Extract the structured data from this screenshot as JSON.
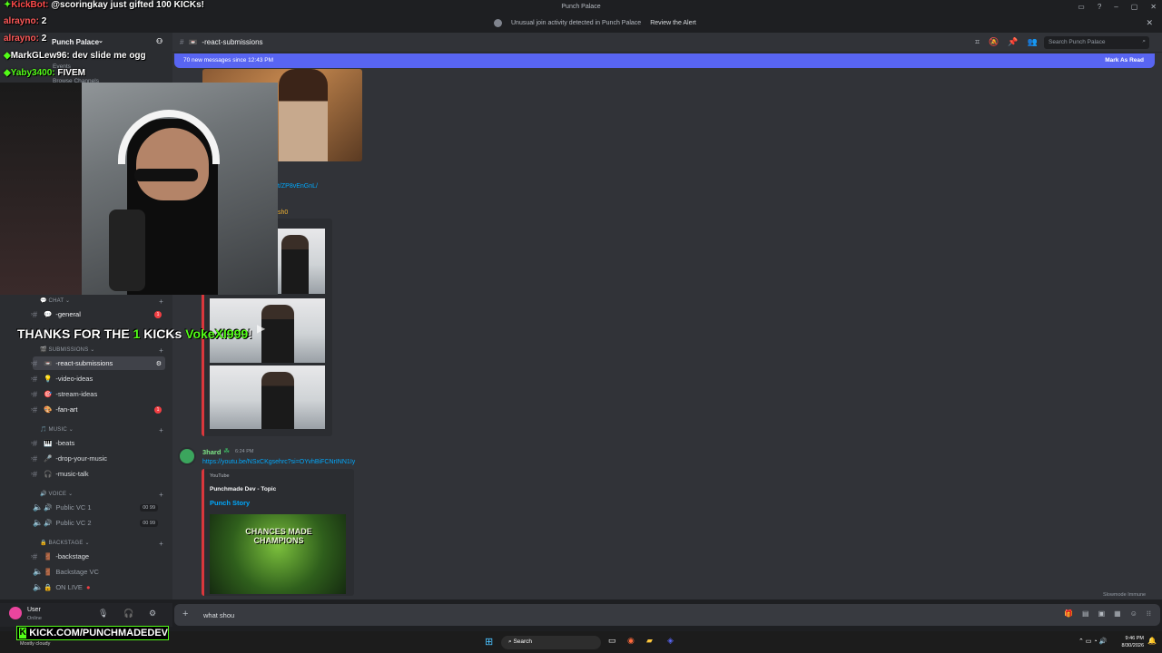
{
  "window": {
    "title": "Punch Palace"
  },
  "alert": {
    "text": "Unusual join activity detected in Punch Palace",
    "action": "Review the Alert"
  },
  "server": {
    "name": "Punch Palace",
    "hidden_items": [
      "Events",
      "Browse Channels"
    ]
  },
  "channel_header": {
    "name": "-react-submissions",
    "search_placeholder": "Search Punch Palace"
  },
  "new_messages": {
    "text": "70 new messages since 12:43 PM",
    "action": "Mark As Read"
  },
  "categories": {
    "chat": "CHAT",
    "submissions": "SUBMISSIONS",
    "music": "MUSIC",
    "voice": "VOICE",
    "backstage": "BACKSTAGE"
  },
  "channels": {
    "general": "-general",
    "react_submissions": "-react-submissions",
    "video_ideas": "-video-ideas",
    "stream_ideas": "-stream-ideas",
    "fan_art": "-fan-art",
    "beats": "-beats",
    "drop_your_music": "-drop-your-music",
    "music_talk": "-music-talk",
    "public_vc1": "Public VC 1",
    "public_vc2": "Public VC 2",
    "backstage": "-backstage",
    "backstage_vc": "Backstage VC",
    "on_live": "ON LIVE"
  },
  "badges": {
    "general": "1",
    "fan_art": "1"
  },
  "voice_counts": {
    "vc1": "00  99",
    "vc2": "00  99"
  },
  "messages": {
    "partial_link": "t/ZP8vEnGnL/",
    "partial_user": "sh0",
    "author": "3hard",
    "time": "6:24 PM",
    "link": "https://youtu.be/NSxCKgsehrc?si=OYvhBiFCNrINN1Iy",
    "provider": "YouTube",
    "embed_author": "Punchmade Dev - Topic",
    "embed_title": "Punch Story",
    "thumb_text": "CHANCES MADE CHAMPIONS"
  },
  "slowmode": "Slowmode Immune",
  "input": {
    "value": "what shou"
  },
  "user": {
    "name": "User",
    "status": "Online"
  },
  "weather": "Mostly cloudy",
  "taskbar": {
    "search": "Search",
    "time": "9:46 PM",
    "date": "8/30/2026"
  },
  "overlay": {
    "line1_user": "KickBot:",
    "line1_text": "@scoringkay just gifted 100 KICKs!",
    "line2_user": "alrayno:",
    "line2_text": "2",
    "line3_user": "alrayno:",
    "line3_text": "2",
    "line4_user": "MarkGLew96:",
    "line4_text": "dev slide me ogg",
    "line5_user": "Yaby3400:",
    "line5_text": "FIVEM",
    "thanks_prefix": "THANKS FOR THE",
    "thanks_count": "1",
    "thanks_mid": "KICKs",
    "thanks_user": "VokeXI999",
    "thanks_suffix": "!",
    "kick_url": "KICK.COM/PUNCHMADEDEV"
  },
  "colors": {
    "accent": "#5865f2",
    "kick_green": "#53fc18",
    "danger": "#f23f43"
  }
}
